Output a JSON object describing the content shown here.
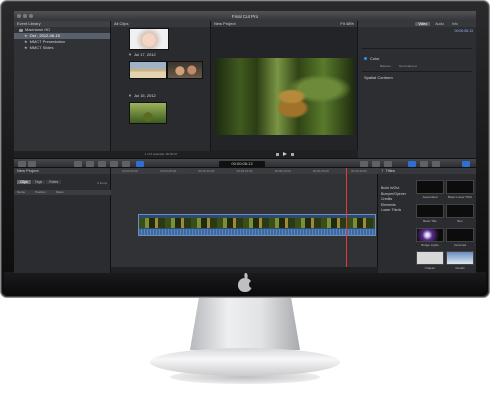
{
  "window": {
    "title": "Final Cut Pro"
  },
  "library": {
    "header": "Event Library",
    "drive": "Macintosh HD",
    "items": [
      {
        "label": "Oct - 2012-06-15"
      },
      {
        "label": "MMCT Presentation"
      },
      {
        "label": "MMCT Slides"
      }
    ]
  },
  "browser": {
    "header": "All Clips",
    "date_groups": [
      {
        "label": "Jul 17, 2012"
      },
      {
        "label": "Jul 15, 2012"
      }
    ],
    "footer": "1 of 6 selected, 00:00:37"
  },
  "viewer": {
    "header": "New Project",
    "fit": "Fit",
    "zoom": "48%"
  },
  "inspector": {
    "tabs": [
      "Video",
      "Audio",
      "Info"
    ],
    "timecode": "00:00:06:13",
    "rows": [
      {
        "label": "Color"
      },
      {
        "label": "Spatial Conform"
      }
    ],
    "balance_label": "Balance",
    "balance_value": "Not Analyzed"
  },
  "toolbar": {
    "timecode": "00:00:06:13"
  },
  "index": {
    "header": "New Project",
    "tabs": [
      "Clips",
      "Tags",
      "Roles"
    ],
    "count": "0 items",
    "columns": [
      "Name",
      "Position",
      "Notes"
    ]
  },
  "timeline": {
    "ruler": [
      "00:00:00:00",
      "00:00:05:00",
      "00:00:10:00",
      "00:00:15:00",
      "00:00:20:00",
      "00:00:25:00",
      "00:00:30:00"
    ]
  },
  "titles": {
    "header": "Titles",
    "categories": [
      "Build In/Out",
      "Bumper/Opener",
      "Credits",
      "Elements",
      "Lower Thirds"
    ],
    "grid": [
      {
        "label": "Assembled"
      },
      {
        "label": "Basic Lower Third"
      },
      {
        "label": "Basic Title"
      },
      {
        "label": "Boo"
      },
      {
        "label": "Bridge Lights"
      },
      {
        "label": "Centered"
      },
      {
        "label": "Chapter"
      },
      {
        "label": "Clouds"
      }
    ]
  }
}
